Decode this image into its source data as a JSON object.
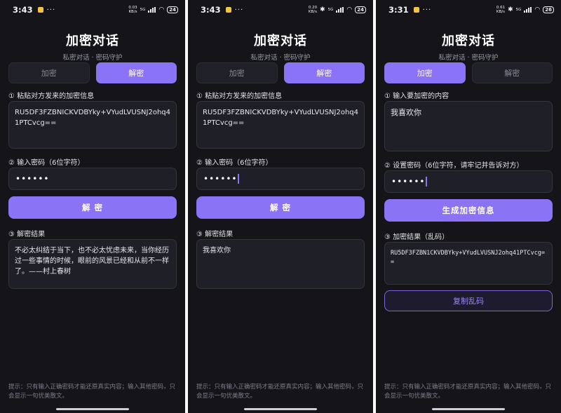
{
  "app": {
    "title": "加密对话",
    "subtitle": "私密对话 · 密码守护",
    "tab_encrypt": "加密",
    "tab_decrypt": "解密",
    "hint": "提示：只有输入正确密码才能还原真实内容；输入其他密码，只会显示一句优美散文。"
  },
  "screens": [
    {
      "status": {
        "time": "3:43",
        "speed": "0.03",
        "speed_unit": "KB/s",
        "network": "5G",
        "battery": "24"
      },
      "active_tab": "decrypt",
      "step1_label": "① 粘贴对方发来的加密信息",
      "cipher_input": "RU5DF3FZBNICKVDBYky+VYudLVUSNJ2ohq41PTCvcg==",
      "step2_label": "② 输入密码（6位字符）",
      "password_mask": "••••••",
      "action_button": "解 密",
      "step3_label": "③ 解密结果",
      "result": "不必太纠结于当下，也不必太忧虑未来，当你经历过一些事情的时候，眼前的风景已经和从前不一样了。——村上春树"
    },
    {
      "status": {
        "time": "3:43",
        "speed": "0.20",
        "speed_unit": "KB/s",
        "network": "5G",
        "battery": "24"
      },
      "active_tab": "decrypt",
      "step1_label": "① 粘贴对方发来的加密信息",
      "cipher_input": "RU5DF3FZBNICKVDBYky+VYudLVUSNJ2ohq41PTCvcg==",
      "step2_label": "② 输入密码（6位字符）",
      "password_mask": "••••••",
      "action_button": "解 密",
      "step3_label": "③ 解密结果",
      "result": "我喜欢你"
    },
    {
      "status": {
        "time": "3:31",
        "speed": "0.61",
        "speed_unit": "KB/s",
        "network": "5G",
        "battery": "26"
      },
      "active_tab": "encrypt",
      "step1_label": "① 输入要加密的内容",
      "plain_input": "我喜欢你",
      "step2_label": "② 设置密码（6位字符，请牢记并告诉对方）",
      "password_mask": "••••••",
      "action_button": "生成加密信息",
      "step3_label": "③ 加密结果（乱码）",
      "cipher_output": "RU5DF3FZBN1CKVDBYky+VYudLVUSNJ2ohq41PTCvcg==",
      "copy_button": "复制乱码"
    }
  ],
  "colors": {
    "background": "#141419",
    "accent": "#8b73f5",
    "field": "#1f1f27"
  }
}
